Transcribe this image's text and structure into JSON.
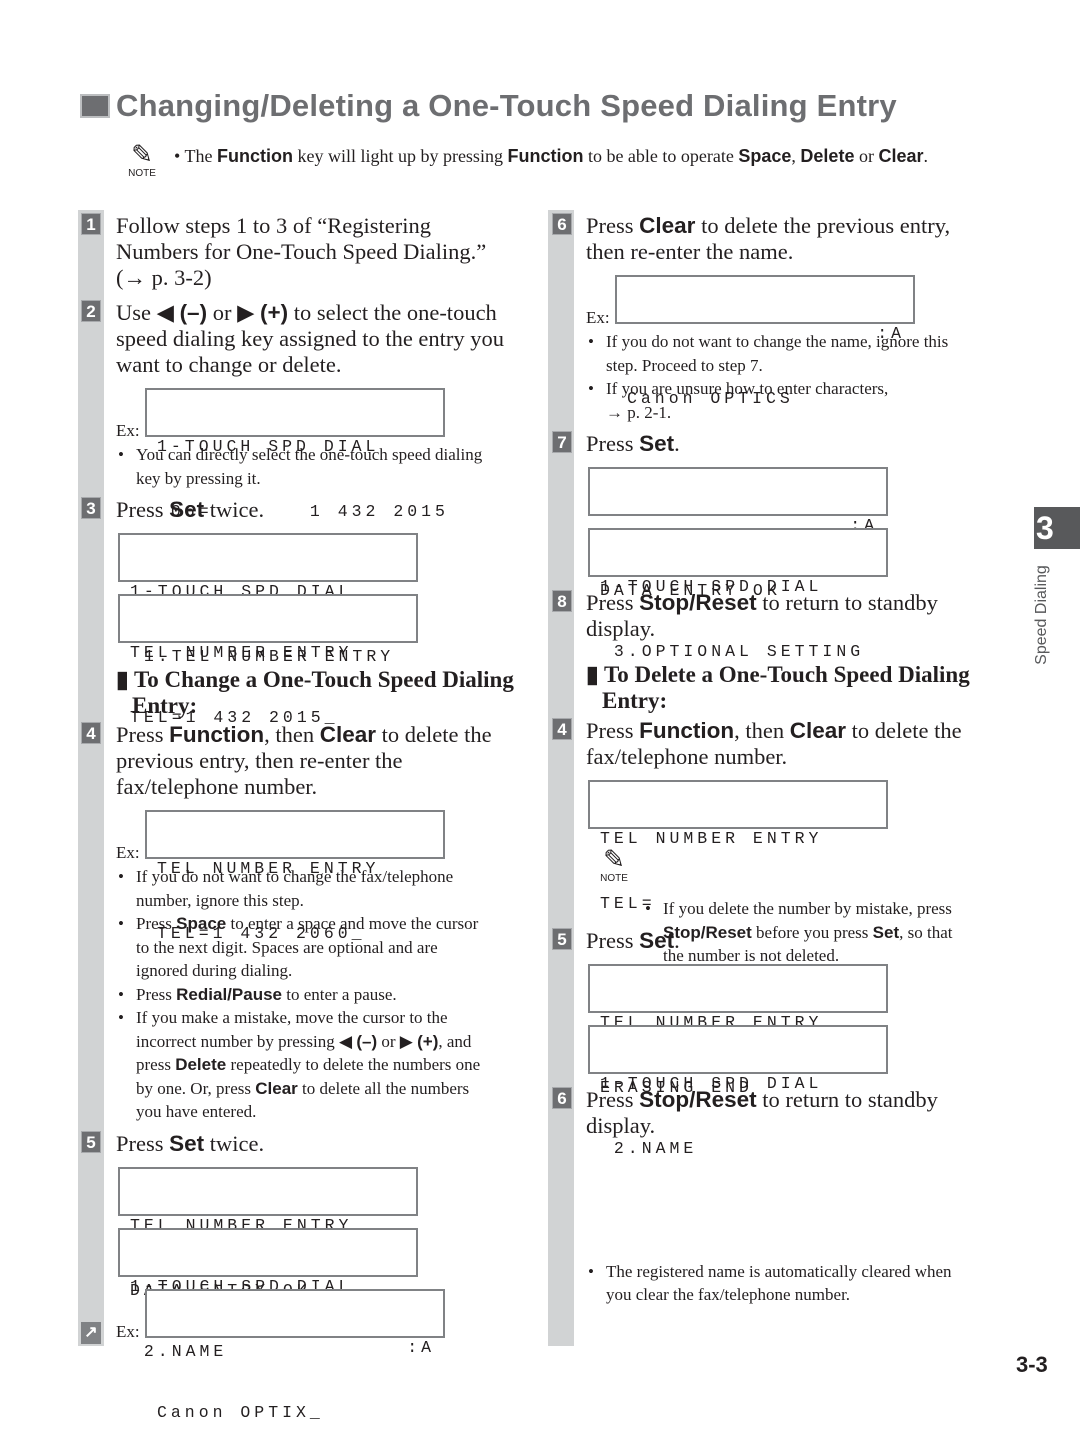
{
  "page": {
    "title": "Changing/Deleting a One-Touch Speed Dialing Entry",
    "page_number": "3-3",
    "chapter_tab": {
      "number": "3",
      "label": "Speed Dialing"
    }
  },
  "top_note": {
    "icon_label": "NOTE",
    "parts": [
      "The ",
      "Function",
      " key will light up by pressing ",
      "Function",
      " to be able to operate ",
      "Space",
      ", ",
      "Delete",
      " or ",
      "Clear",
      "."
    ]
  },
  "left": {
    "step1": {
      "num": "1",
      "lines": [
        "Follow steps 1 to 3 of “Registering",
        "Numbers for One-Touch Speed Dialing.”",
        "(→ p. 3-2)"
      ]
    },
    "step2": {
      "num": "2",
      "line1_a": "Use ",
      "left_arrow": "◀",
      "minus": "(–)",
      "or": " or ",
      "right_arrow": "▶",
      "plus": "(+)",
      "line1_b": " to select the one-touch",
      "line2": "speed dialing key assigned to the entry you",
      "line3": "want to change or delete.",
      "ex_label": "Ex:",
      "lcd": [
        "1-TOUCH SPD DIAL",
        " 06=       1 432 2015"
      ],
      "bullet_lines": [
        "You can directly select the one-touch speed dialing",
        "key by pressing it."
      ]
    },
    "step3": {
      "num": "3",
      "pre": "Press ",
      "key": "Set",
      "post": " twice.",
      "lcd1": [
        "1-TOUCH SPD DIAL",
        " 1.TEL NUMBER ENTRY"
      ],
      "lcd2": [
        "TEL NUMBER ENTRY",
        "TEL=1 432 2015_"
      ]
    },
    "subheading": {
      "marker": "▮",
      "lines": [
        "To Change a One-Touch Speed Dialing",
        "Entry:"
      ]
    },
    "step4": {
      "num": "4",
      "pre": "Press ",
      "key1": "Function",
      "mid": ", then ",
      "key2": "Clear",
      "post": " to delete the",
      "line2": "previous entry, then re-enter the",
      "line3": "fax/telephone number.",
      "ex_label": "Ex:",
      "lcd": [
        "TEL NUMBER ENTRY",
        "TEL=1 432 2060_"
      ],
      "bullets": [
        {
          "lines": [
            "If you do not want to change the fax/telephone",
            "number, ignore this step."
          ]
        },
        {
          "pre": "Press ",
          "key": "Space",
          "post": " to enter a space and move the cursor",
          "lines": [
            "to the next digit. Spaces are optional and are",
            "ignored during dialing."
          ]
        },
        {
          "pre": "Press ",
          "key": "Redial/Pause",
          "post": " to enter a pause."
        },
        {
          "line1": "If you make a mistake, move the cursor to the",
          "l2_pre": "incorrect number by pressing ",
          "l2_left": "◀",
          "l2_minus": "(–)",
          "l2_or": " or ",
          "l2_right": "▶",
          "l2_plus": "(+)",
          "l2_post": ", and",
          "l3_pre": "press ",
          "l3_key": "Delete",
          "l3_post": " repeatedly to delete the numbers one",
          "l4_pre": "by one. Or, press ",
          "l4_key": "Clear",
          "l4_post": " to delete all the numbers",
          "l5": "you have entered."
        }
      ]
    },
    "step5": {
      "num": "5",
      "pre": "Press ",
      "key": "Set",
      "post": " twice.",
      "lcd1": [
        "TEL NUMBER ENTRY",
        "DATA ENTRY OK"
      ],
      "lcd2": [
        "1-TOUCH SPD DIAL",
        " 2.NAME"
      ],
      "ex_label": "Ex:",
      "lcd3": [
        ":A",
        "Canon OPTIX_"
      ],
      "continue_icon": "↗"
    }
  },
  "right": {
    "step6": {
      "num": "6",
      "pre": "Press ",
      "key": "Stop/Reset",
      "post": " to return to standby",
      "line2": "display.",
      "bullet_lines": [
        "The registered name is automatically cleared when",
        "you clear the fax/telephone number."
      ]
    },
    "step7": {
      "num": "7",
      "pre": "Press ",
      "key": "Set",
      "post": ".",
      "lcd1": [
        ":A",
        "DATA ENTRY OK"
      ],
      "lcd2": [
        "1-TOUCH SPD DIAL",
        " 3.OPTIONAL SETTING"
      ]
    },
    "step8": {
      "num": "8",
      "pre": "Press ",
      "key": "Stop/Reset",
      "post": " to return to standby",
      "line2": "display."
    },
    "subheading": {
      "marker": "▮",
      "lines": [
        "To Delete a One-Touch Speed Dialing",
        "Entry:"
      ]
    },
    "step4": {
      "num": "4",
      "pre": "Press ",
      "key1": "Function",
      "mid": ", then ",
      "key2": "Clear",
      "post": " to delete the",
      "line2": "fax/telephone number.",
      "lcd": [
        "TEL NUMBER ENTRY",
        "TEL="
      ],
      "note": {
        "icon_label": "NOTE",
        "line1": "If you delete the number by mistake, press",
        "l2_key1": "Stop/Reset",
        "l2_mid": " before you press ",
        "l2_key2": "Set",
        "l2_post": ", so that",
        "line3": "the number is not deleted."
      }
    },
    "step5": {
      "num": "5",
      "pre": "Press ",
      "key": "Set",
      "post": ".",
      "lcd1": [
        "TEL NUMBER ENTRY",
        "ERASING END"
      ],
      "lcd2": [
        "1-TOUCH SPD DIAL",
        " 2.NAME"
      ]
    }
  }
}
